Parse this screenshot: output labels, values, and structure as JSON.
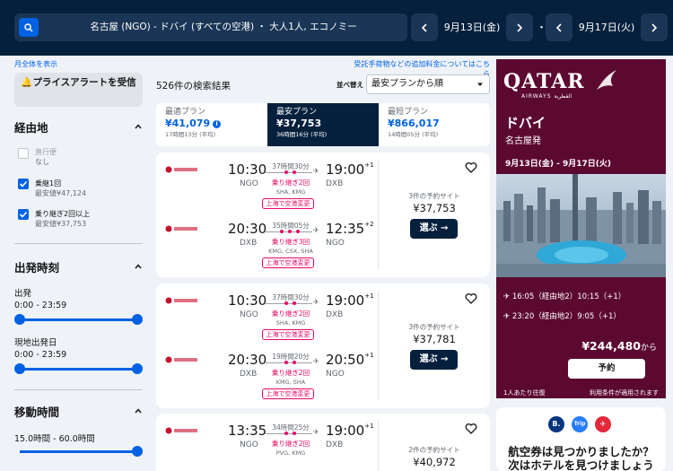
{
  "search": {
    "query": "名古屋 (NGO) - ドバイ (すべての空港) ・ 大人1人, エコノミー",
    "depart_date": "9月13日(金)",
    "return_date": "9月17日(火)",
    "separator": "・"
  },
  "sidebar": {
    "show_all": "月全体を表示",
    "price_alert": "プライスアラートを受信",
    "stops_title": "経由地",
    "stops": [
      {
        "label": "直行便",
        "sub": "なし",
        "checked": false,
        "disabled": true
      },
      {
        "label": "乗継1回",
        "sub": "最安値¥47,124",
        "checked": true,
        "disabled": false
      },
      {
        "label": "乗り継ぎ2回以上",
        "sub": "最安値¥37,753",
        "checked": true,
        "disabled": false
      }
    ],
    "depart_title": "出発時刻",
    "outbound_label": "出発",
    "outbound_range": "0:00 - 23:59",
    "return_label": "現地出発日",
    "return_range": "0:00 - 23:59",
    "duration_title": "移動時間",
    "duration_range": "15.0時間 - 60.0時間"
  },
  "results": {
    "baggage_link": "受託手荷物などの追加料金についてはこちら",
    "count": "526件の検索結果",
    "sort_label": "並べ替え",
    "sort_value": "最安プランから順"
  },
  "tabs": [
    {
      "label": "最適プラン",
      "price": "¥41,079",
      "sub": "17時間13分 (平均)",
      "info": true
    },
    {
      "label": "最安プラン",
      "price": "¥37,753",
      "sub": "36時間16分 (平均)"
    },
    {
      "label": "最短プラン",
      "price": "¥866,017",
      "sub": "14時間05分 (平均)"
    }
  ],
  "cards": [
    {
      "legs": [
        {
          "dep_time": "10:30",
          "dep_apt": "NGO",
          "arr_time": "19:00",
          "arr_sup": "+1",
          "arr_apt": "DXB",
          "duration": "37時間30分",
          "stops": "乗り継ぎ2回",
          "via": "SHA, KMG",
          "badge": "上海で空港変更"
        },
        {
          "dep_time": "20:30",
          "dep_apt": "DXB",
          "arr_time": "12:35",
          "arr_sup": "+2",
          "arr_apt": "NGO",
          "duration": "35時間05分",
          "stops": "乗り継ぎ3回",
          "via": "KMG, CSX, SHA",
          "badge": "上海で空港変更"
        }
      ],
      "sites": "3件の予約サイト",
      "price": "¥37,753",
      "select": "選ぶ →"
    },
    {
      "legs": [
        {
          "dep_time": "10:30",
          "dep_apt": "NGO",
          "arr_time": "19:00",
          "arr_sup": "+1",
          "arr_apt": "DXB",
          "duration": "37時間30分",
          "stops": "乗り継ぎ2回",
          "via": "SHA, KMG",
          "badge": "上海で空港変更"
        },
        {
          "dep_time": "20:30",
          "dep_apt": "DXB",
          "arr_time": "20:50",
          "arr_sup": "+1",
          "arr_apt": "NGO",
          "duration": "19時間20分",
          "stops": "乗り継ぎ2回",
          "via": "KMG, SHA",
          "badge": "上海で空港変更"
        }
      ],
      "sites": "3件の予約サイト",
      "price": "¥37,781",
      "select": "選ぶ →"
    },
    {
      "legs": [
        {
          "dep_time": "13:35",
          "dep_apt": "NGO",
          "arr_time": "19:00",
          "arr_sup": "+1",
          "arr_apt": "DXB",
          "duration": "34時間25分",
          "stops": "乗り継ぎ2回",
          "via": "PVG, KMG",
          "badge": ""
        }
      ],
      "sites": "2件の予約サイト",
      "price": "¥40,972",
      "select": "選ぶ →"
    }
  ],
  "ad": {
    "logo": "QATAR",
    "logo_sub": "AIRWAYS القطرية",
    "title": "ドバイ",
    "subtitle": "名古屋発",
    "dates": "9月13日(金) - 9月17日(火)",
    "flight1": "16:05（経由地2）10:15（+1）",
    "flight2": "23:20（経由地2）9:05（+1）",
    "price": "¥244,480",
    "price_suffix": "から",
    "button": "予約",
    "foot_left": "1人あたり往復",
    "foot_right": "利用条件が適用されます"
  },
  "hotel": {
    "icons": [
      "B.",
      "Trip",
      "✈"
    ],
    "line1": "航空券は見つかりましたか？",
    "line2": "次はホテルを見つけましょう"
  },
  "colors": {
    "navy": "#05203c",
    "blue": "#0062e3",
    "pink": "#e70866",
    "qatar": "#5c0931"
  }
}
